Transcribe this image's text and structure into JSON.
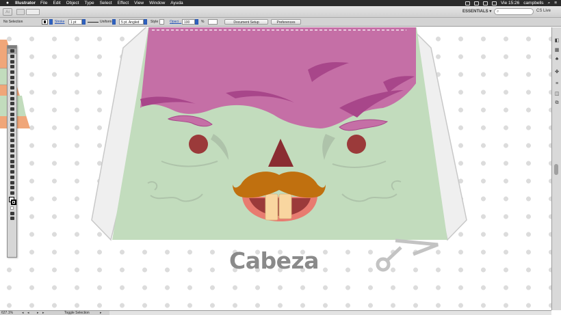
{
  "menubar": {
    "apple_icon": "apple-logo-icon",
    "app_name": "Illustrator",
    "items": [
      "File",
      "Edit",
      "Object",
      "Type",
      "Select",
      "Effect",
      "View",
      "Window",
      "Ayuda"
    ],
    "clock": "Vie 15:26",
    "user": "campbells"
  },
  "appbar": {
    "logo": "Ai",
    "workspace": "ESSENTIALS ▾",
    "search_icon": "search-icon",
    "cslive": "CS Live"
  },
  "control": {
    "selection": "No Selection",
    "stroke_label": "Stroke",
    "stroke_weight": "1 pt",
    "profile": "Uniform",
    "brush": "5 pt. Angled",
    "style_label": "Style",
    "opacity_label": "Opaci...",
    "opacity_value": "100",
    "opacity_unit": "%",
    "document_setup": "Document Setup",
    "preferences": "Preferences"
  },
  "artwork": {
    "label": "Cabeza",
    "colors": {
      "hair": "#c56fa6",
      "hair_dark": "#a8468a",
      "face": "#c2dcbd",
      "face_shadow": "#aec3aa",
      "eye": "#9b3a3a",
      "nose": "#8a2d32",
      "mustache": "#c0700f",
      "mouth": "#e87b70",
      "teeth": "#f9d6a0",
      "flaps": "#f0f0f0",
      "text": "#8a8a8a"
    }
  },
  "statusbar": {
    "zoom": "627.1%",
    "selection_mode": "Toggle Selection"
  }
}
